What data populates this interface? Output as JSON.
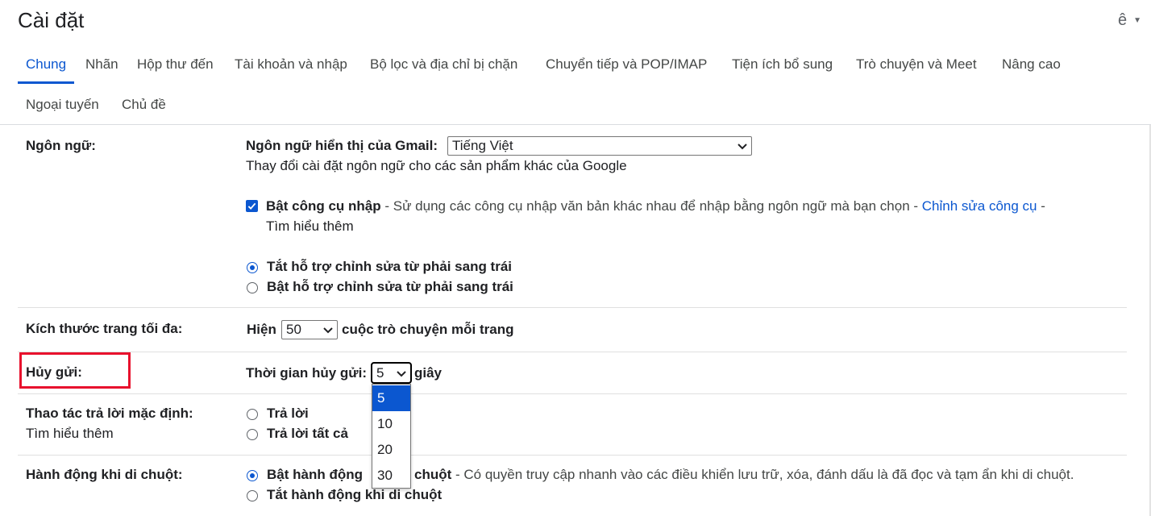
{
  "header": {
    "title": "Cài đặt",
    "input_tool": "ê"
  },
  "tabs": [
    {
      "label": "Chung"
    },
    {
      "label": "Nhãn"
    },
    {
      "label": "Hộp thư đến"
    },
    {
      "label": "Tài khoản và nhập"
    },
    {
      "label": "Bộ lọc và địa chỉ bị chặn"
    },
    {
      "label": "Chuyển tiếp và POP/IMAP"
    },
    {
      "label": "Tiện ích bổ sung"
    },
    {
      "label": "Trò chuyện và Meet"
    },
    {
      "label": "Nâng cao"
    },
    {
      "label": "Ngoại tuyến"
    },
    {
      "label": "Chủ đề"
    }
  ],
  "active_tab": "Chung",
  "language": {
    "label": "Ngôn ngữ:",
    "display_label": "Ngôn ngữ hiển thị của Gmail:",
    "display_value": "Tiếng Việt",
    "other_products_link": "Thay đổi cài đặt ngôn ngữ cho các sản phẩm khác của Google",
    "input_tools_title": "Bật công cụ nhập",
    "input_tools_desc": " - Sử dụng các công cụ nhập văn bản khác nhau để nhập bằng ngôn ngữ mà bạn chọn - ",
    "input_tools_edit_link": "Chỉnh sửa công cụ",
    "input_tools_sep": " -",
    "learn_more": "Tìm hiểu thêm",
    "input_tools_checked": true,
    "rtl_off": "Tắt hỗ trợ chỉnh sửa từ phải sang trái",
    "rtl_on": "Bật hỗ trợ chỉnh sửa từ phải sang trái",
    "rtl_selected": "off"
  },
  "page_size": {
    "label": "Kích thước trang tối đa:",
    "prefix": "Hiện",
    "value": "50",
    "suffix": "cuộc trò chuyện mỗi trang"
  },
  "undo_send": {
    "label": "Hủy gửi:",
    "period_label": "Thời gian hủy gửi:",
    "value": "5",
    "suffix": "giây",
    "options": [
      "5",
      "10",
      "20",
      "30"
    ]
  },
  "reply_behavior": {
    "label": "Thao tác trả lời mặc định:",
    "learn_more": "Tìm hiểu thêm",
    "reply": "Trả lời",
    "reply_all": "Trả lời tất cả"
  },
  "hover_actions": {
    "label": "Hành động khi di chuột:",
    "enable_title": "Bật hành động",
    "enable_title_tail": "chuột",
    "enable_desc": " - Có quyền truy cập nhanh vào các điều khiển lưu trữ, xóa, đánh dấu là đã đọc và tạm ẩn khi di chuột.",
    "disable": "Tắt hành động khi di chuột",
    "selected": "enable"
  },
  "colors": {
    "accent": "#0b57d0",
    "highlight": "#e8112d"
  }
}
